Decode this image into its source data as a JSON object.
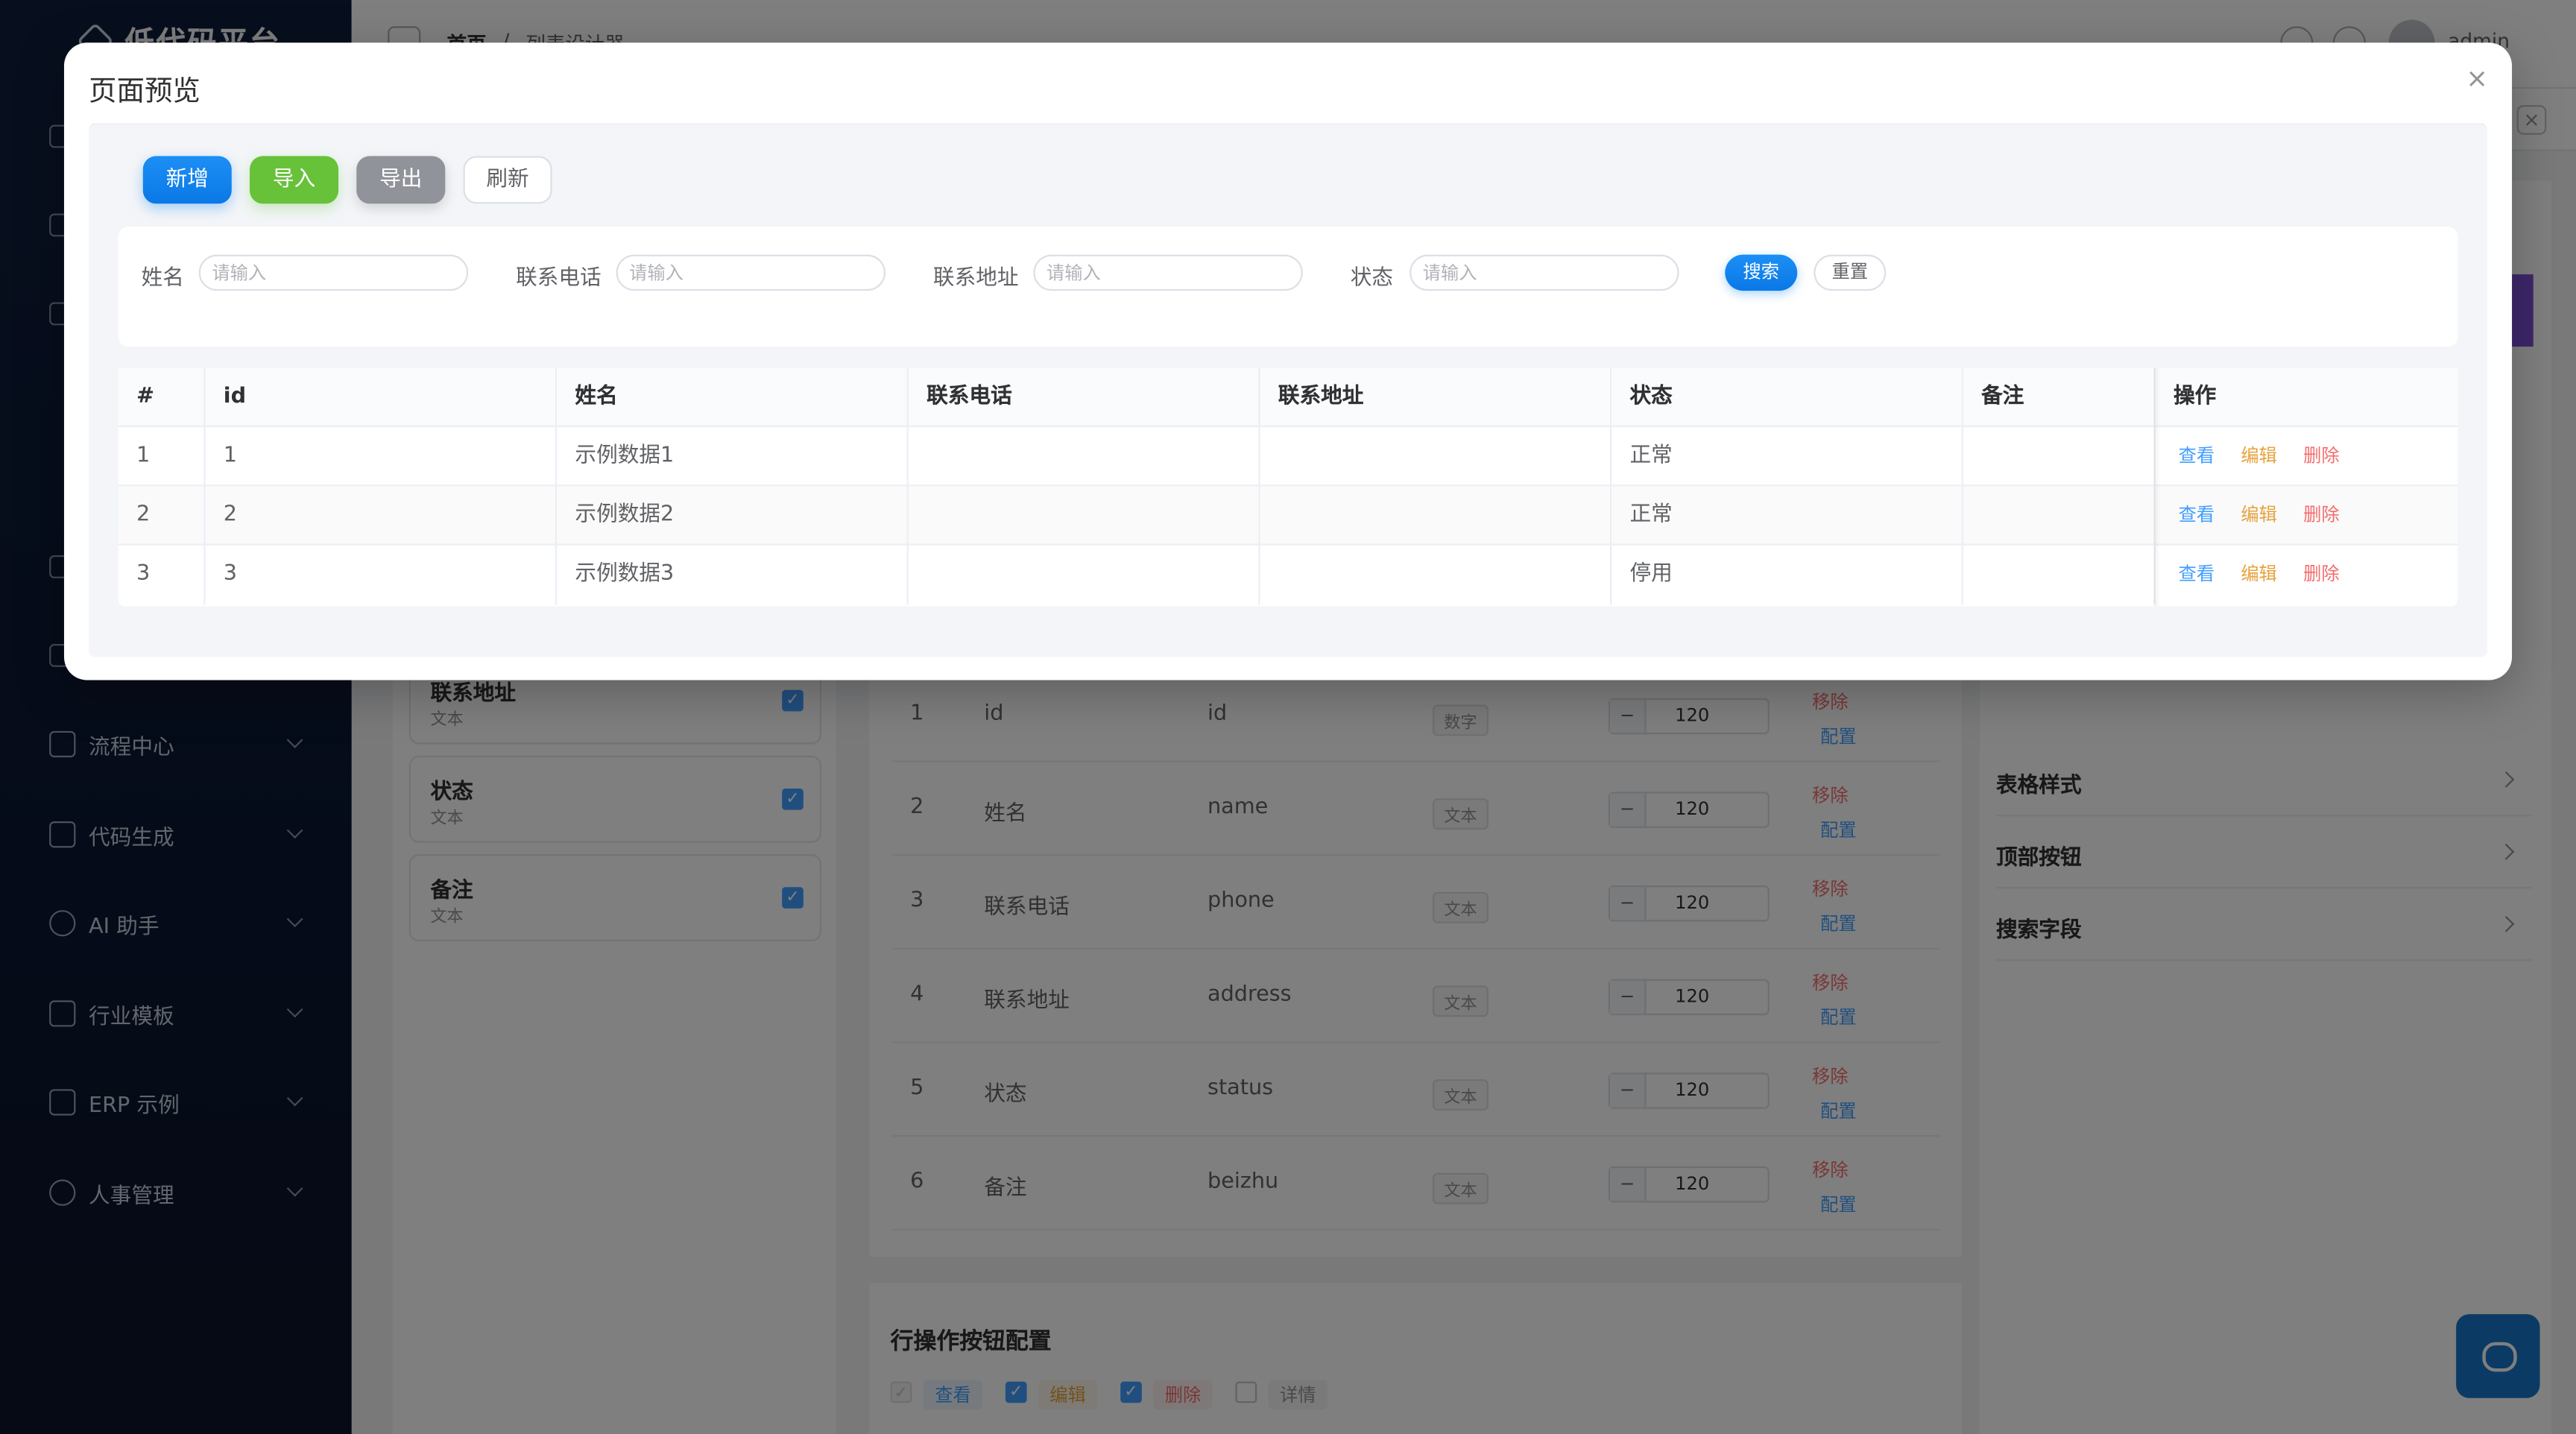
{
  "app": {
    "title": "低代码平台"
  },
  "header": {
    "breadcrumb": [
      "首页",
      "/",
      "列表设计器"
    ],
    "user": "admin"
  },
  "sidebar": {
    "items": [
      {
        "label": "流程中心",
        "icon": "flow-icon"
      },
      {
        "label": "代码生成",
        "icon": "download-icon"
      },
      {
        "label": "AI 助手",
        "icon": "chat-icon"
      },
      {
        "label": "行业模板",
        "icon": "grid-icon"
      },
      {
        "label": "ERP 示例",
        "icon": "building-icon"
      },
      {
        "label": "人事管理",
        "icon": "user-icon"
      }
    ]
  },
  "background": {
    "fields": [
      {
        "name": "联系地址",
        "type": "文本"
      },
      {
        "name": "状态",
        "type": "文本"
      },
      {
        "name": "备注",
        "type": "文本"
      }
    ],
    "columns": [
      {
        "no": "1",
        "label": "id",
        "key": "id",
        "type": "数字",
        "width": "120"
      },
      {
        "no": "2",
        "label": "姓名",
        "key": "name",
        "type": "文本",
        "width": "120"
      },
      {
        "no": "3",
        "label": "联系电话",
        "key": "phone",
        "type": "文本",
        "width": "120"
      },
      {
        "no": "4",
        "label": "联系地址",
        "key": "address",
        "type": "文本",
        "width": "120"
      },
      {
        "no": "5",
        "label": "状态",
        "key": "status",
        "type": "文本",
        "width": "120"
      },
      {
        "no": "6",
        "label": "备注",
        "key": "beizhu",
        "type": "文本",
        "width": "120"
      }
    ],
    "remove_label": "移除",
    "config_label": "配置",
    "right_panel": [
      "表格样式",
      "顶部按钮",
      "搜索字段"
    ],
    "row_ops": {
      "title": "行操作按钮配置",
      "items": [
        {
          "label": "查看",
          "checked": true,
          "disabled": true
        },
        {
          "label": "编辑",
          "checked": true
        },
        {
          "label": "删除",
          "checked": true
        },
        {
          "label": "详情",
          "checked": false
        }
      ]
    }
  },
  "dialog": {
    "title": "页面预览",
    "close": "×",
    "buttons": {
      "add": "新增",
      "import": "导入",
      "export": "导出",
      "refresh": "刷新"
    },
    "search": {
      "fields": [
        {
          "label": "姓名",
          "placeholder": "请输入"
        },
        {
          "label": "联系电话",
          "placeholder": "请输入"
        },
        {
          "label": "联系地址",
          "placeholder": "请输入"
        },
        {
          "label": "状态",
          "placeholder": "请输入"
        }
      ],
      "search_btn": "搜索",
      "reset_btn": "重置"
    },
    "table": {
      "headers": [
        "#",
        "id",
        "姓名",
        "联系电话",
        "联系地址",
        "状态",
        "备注",
        "操作"
      ],
      "rows": [
        {
          "idx": "1",
          "id": "1",
          "name": "示例数据1",
          "phone": "",
          "address": "",
          "status": "正常",
          "note": ""
        },
        {
          "idx": "2",
          "id": "2",
          "name": "示例数据2",
          "phone": "",
          "address": "",
          "status": "正常",
          "note": ""
        },
        {
          "idx": "3",
          "id": "3",
          "name": "示例数据3",
          "phone": "",
          "address": "",
          "status": "停用",
          "note": ""
        }
      ],
      "actions": {
        "view": "查看",
        "edit": "编辑",
        "delete": "删除"
      }
    }
  },
  "colors": {
    "primary": "#1a8cf2",
    "success": "#67c23a",
    "info": "#909399",
    "warning": "#e6a23c",
    "danger": "#f56c6c"
  }
}
